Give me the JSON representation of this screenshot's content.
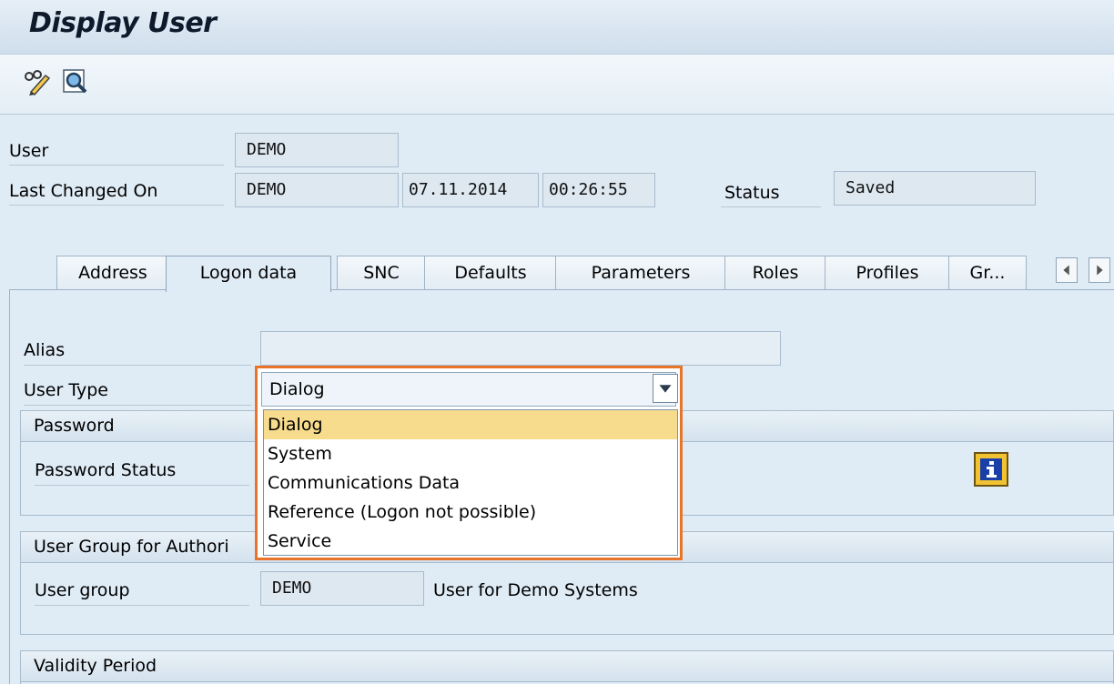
{
  "window": {
    "title": "Display User"
  },
  "toolbar": {
    "change_icon": "pencil-glasses-icon",
    "display_icon": "magnifier-icon"
  },
  "header": {
    "user_label": "User",
    "user_value": "DEMO",
    "last_changed_label": "Last Changed On",
    "last_changed_by": "DEMO",
    "last_changed_date": "07.11.2014",
    "last_changed_time": "00:26:55",
    "status_label": "Status",
    "status_value": "Saved"
  },
  "tabs": [
    {
      "label": "Address"
    },
    {
      "label": "Logon data",
      "active": true
    },
    {
      "label": "SNC"
    },
    {
      "label": "Defaults"
    },
    {
      "label": "Parameters"
    },
    {
      "label": "Roles"
    },
    {
      "label": "Profiles"
    },
    {
      "label": "Gr..."
    }
  ],
  "logon": {
    "alias_label": "Alias",
    "alias_value": "",
    "user_type_label": "User Type",
    "user_type_value": "Dialog",
    "user_type_options": [
      "Dialog",
      "System",
      "Communications Data",
      "Reference (Logon not possible)",
      "Service"
    ],
    "password_group": "Password",
    "password_status_label": "Password Status",
    "auth_group": "User Group for Authori",
    "user_group_label": "User group",
    "user_group_value": "DEMO",
    "user_group_desc": "User for Demo Systems",
    "validity_group": "Validity Period"
  },
  "colors": {
    "highlight": "#e8742a",
    "selected_option": "#f7dc8e",
    "background": "#dfebf5"
  }
}
